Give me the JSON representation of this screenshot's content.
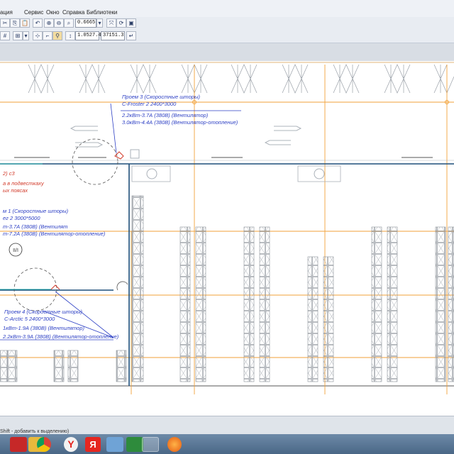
{
  "menu": {
    "items": [
      "ация",
      "Сервис",
      "Окно",
      "Справка",
      "Библиотеки"
    ]
  },
  "toolbar": {
    "zoom_value": "0.6665",
    "coord_x": "1.0527.4",
    "coord_y": "37151.3"
  },
  "drawing": {
    "room_3_title": "Проем 3 (Скоростные шторы)",
    "room_3_model": "С-Froster 2 2400*3000",
    "room_3_line1": "2.2кВт-3.7А (380В)    (Вентилятор)",
    "room_3_line2": "3.0кВт-4.4А (380В)    (Вентилятор-отопление)",
    "red_label": "2) с3",
    "red_note_1": "а в подвесткаху",
    "red_note_2": "ых поясах",
    "room_1_title": "м 1 (Скоростные шторы)",
    "room_1_model": "ег 2 3000*5000",
    "room_1_line1": "т-3.7А (380В)    (Вентилят",
    "room_1_line2": "т-7.2А (380В)    (Вентилятор-отопление)",
    "circle_label": "II/I",
    "room_4_title": "Проем 4 (Скоростные шторы)",
    "room_4_model": "C-Arctic 5 2400*3000",
    "room_4_line1": "1кВт-1.9А (380В)    (Вентилятор)",
    "room_4_line2": "2.2кВт-3.9А (380В)    (Вентилятор-отопление)"
  },
  "status": {
    "hint": "Shift - добавить к выделению)"
  },
  "taskbar": {
    "apps": [
      "acrobat-icon",
      "folder-icon",
      "chrome-icon",
      "yandex-browser-icon",
      "yandex-icon",
      "paint-icon",
      "excel-icon",
      "cad-icon",
      "firefox-icon"
    ]
  },
  "colors": {
    "guide_orange": "#f2a23a",
    "annotation_blue": "#2c3fc4",
    "wall_blue": "#1f4f7a",
    "note_red": "#d23b2b",
    "rack_grey": "#9aa0a8"
  }
}
